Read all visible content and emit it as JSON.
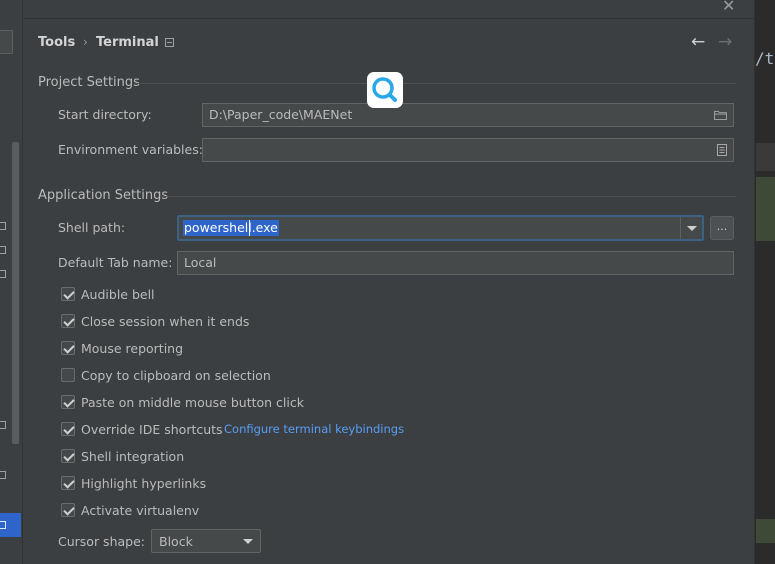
{
  "breadcrumb": {
    "parent": "Tools",
    "separator": "›",
    "current": "Terminal"
  },
  "nav": {
    "back_icon": "arrow-left-icon",
    "forward_icon": "arrow-right-icon"
  },
  "editor": {
    "visible_text": "/t("
  },
  "project_settings": {
    "title": "Project Settings",
    "start_directory": {
      "label": "Start directory:",
      "value": "D:\\Paper_code\\MAENet",
      "icon": "folder-icon"
    },
    "environment_variables": {
      "label": "Environment variables:",
      "value": "",
      "icon": "document-icon"
    }
  },
  "application_settings": {
    "title": "Application Settings",
    "shell_path": {
      "label": "Shell path:",
      "value": "powershell.exe",
      "browse_label": "..."
    },
    "default_tab_name": {
      "label": "Default Tab name:",
      "value": "Local"
    },
    "checkboxes": [
      {
        "label": "Audible bell",
        "checked": true
      },
      {
        "label": "Close session when it ends",
        "checked": true
      },
      {
        "label": "Mouse reporting",
        "checked": true
      },
      {
        "label": "Copy to clipboard on selection",
        "checked": false
      },
      {
        "label": "Paste on middle mouse button click",
        "checked": true
      },
      {
        "label": "Override IDE shortcuts",
        "checked": true
      },
      {
        "label": "Shell integration",
        "checked": true
      },
      {
        "label": "Highlight hyperlinks",
        "checked": true
      },
      {
        "label": "Activate virtualenv",
        "checked": true
      }
    ],
    "configure_link": "Configure terminal keybindings",
    "cursor_shape": {
      "label": "Cursor shape:",
      "value": "Block"
    }
  },
  "colors": {
    "accent": "#2f65ca",
    "link": "#589df6",
    "panel": "#3c3f41",
    "badge": "#2aa7e8"
  }
}
